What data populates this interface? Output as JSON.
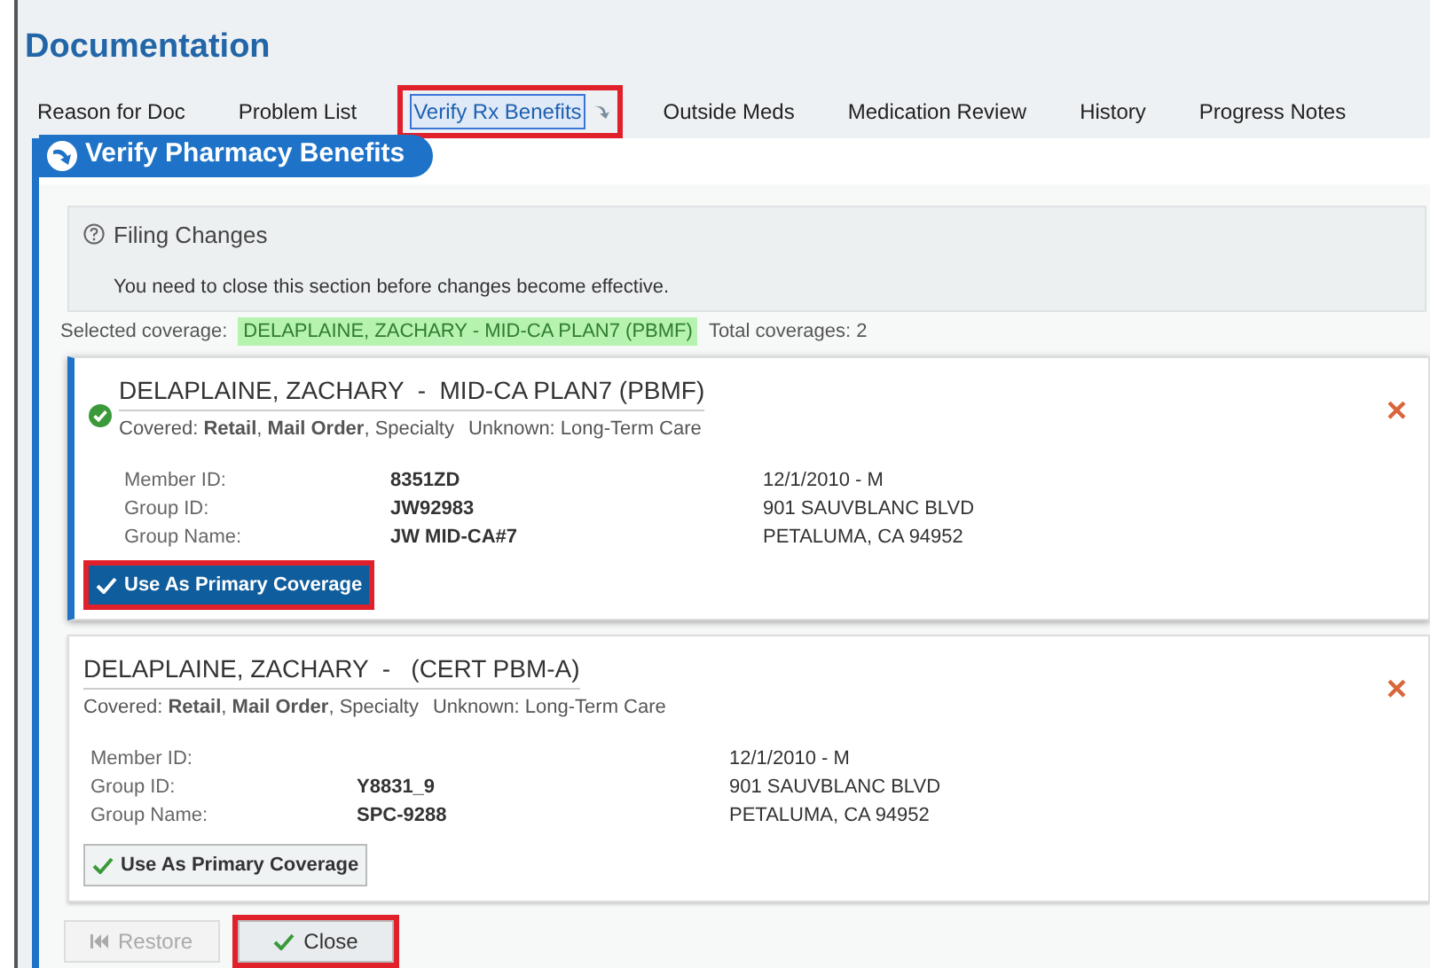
{
  "header": {
    "title": "Documentation"
  },
  "tabs": [
    {
      "label": "Reason for Doc",
      "selected": false,
      "highlighted": false
    },
    {
      "label": "Problem List",
      "selected": false,
      "highlighted": false
    },
    {
      "label": "Verify Rx Benefits",
      "selected": true,
      "highlighted": true
    },
    {
      "label": "Outside Meds",
      "selected": false,
      "highlighted": false
    },
    {
      "label": "Medication Review",
      "selected": false,
      "highlighted": false
    },
    {
      "label": "History",
      "selected": false,
      "highlighted": false
    },
    {
      "label": "Progress Notes",
      "selected": false,
      "highlighted": false
    }
  ],
  "section": {
    "title": "Verify Pharmacy Benefits"
  },
  "notice": {
    "title": "Filing Changes",
    "message": "You need to close this section before changes become effective."
  },
  "summary": {
    "label": "Selected coverage:",
    "selected_coverage": "DELAPLAINE, ZACHARY - MID-CA PLAN7 (PBMF)",
    "total": "Total coverages: 2"
  },
  "coverages": [
    {
      "name": "DELAPLAINE, ZACHARY  -  MID-CA PLAN7 (PBMF)",
      "selected": true,
      "covered": "Covered: **Retail**, **Mail Order**, Specialty",
      "unknown": "Unknown: Long-Term Care",
      "fields": [
        {
          "label": "Member ID:",
          "value": "8351ZD",
          "extra": "12/1/2010 - M"
        },
        {
          "label": "Group ID:",
          "value": "JW92983",
          "extra": "901 SAUVBLANC BLVD"
        },
        {
          "label": "Group Name:",
          "value": "JW MID-CA#7",
          "extra": "PETALUMA, CA 94952"
        }
      ],
      "remove": "×",
      "button": {
        "label": "Use As Primary Coverage",
        "highlighted": true
      }
    },
    {
      "name": "DELAPLAINE, ZACHARY  -   (CERT PBM-A)",
      "selected": false,
      "covered": "Covered: **Retail**, **Mail Order**, Specialty",
      "unknown": "Unknown: Long-Term Care",
      "fields": [
        {
          "label": "Member ID:",
          "extra": "12/1/2010 - M"
        },
        {
          "label": "Group ID:",
          "value": "Y8831_9",
          "extra": "901 SAUVBLANC BLVD"
        },
        {
          "label": "Group Name:",
          "value": "SPC-9288",
          "extra": "PETALUMA, CA 94952"
        }
      ],
      "remove": "×",
      "button": {
        "label": "Use As Primary Coverage",
        "highlighted": false
      }
    }
  ],
  "footer": [
    {
      "kind": "restore",
      "label": "Restore",
      "disabled": true,
      "highlighted": false
    },
    {
      "kind": "close",
      "label": "Close",
      "disabled": false,
      "highlighted": true
    }
  ]
}
